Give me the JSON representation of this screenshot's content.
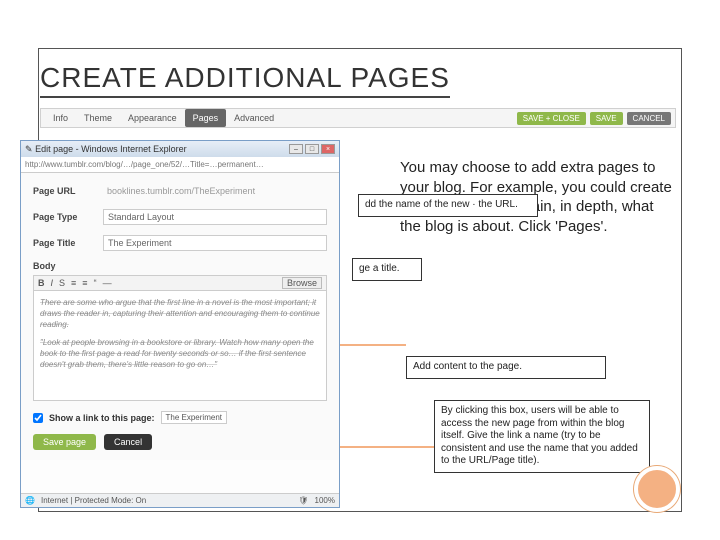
{
  "title": "CREATE ADDITIONAL PAGES",
  "toolbar": {
    "tabs": [
      "Info",
      "Theme",
      "Appearance",
      "Pages",
      "Advanced"
    ],
    "active_index": 3,
    "buttons": {
      "save_close": "SAVE + CLOSE",
      "save": "SAVE",
      "cancel": "CANCEL"
    }
  },
  "browser": {
    "window_title": "Edit page - Windows Internet Explorer",
    "address": "http://www.tumblr.com/blog/…/page_one/52/…Title=…permanent…",
    "page_url_label": "Page URL",
    "page_url_value": "booklines.tumblr.com/TheExperiment",
    "page_type_label": "Page Type",
    "page_type_value": "Standard Layout",
    "page_title_label": "Page Title",
    "page_title_value": "The Experiment",
    "body_label": "Body",
    "editor_toolbar": [
      "B",
      "I",
      "S",
      "≡",
      "≡",
      "“",
      "—",
      "Browse"
    ],
    "body_text_1": "There are some who argue that the first line in a novel is the most important; it draws the reader in, capturing their attention and encouraging them to continue reading.",
    "body_text_2": "\"Look at people browsing in a bookstore or library. Watch how many open the book to the first page a read for twenty seconds or so… if the first sentence doesn't grab them, there's little reason to go on…\"",
    "show_link_label": "Show a link to this page:",
    "show_link_value": "The Experiment",
    "save_page": "Save page",
    "cancel_page": "Cancel",
    "status": "Internet | Protected Mode: On",
    "zoom": "100%"
  },
  "maintext": "You may choose to add extra pages to your blog. For example, you could create a page that will explain, in depth, what the blog is about. Click 'Pages'.",
  "annotations": {
    "a1": "dd the name of the new · the URL.",
    "a2": "ge a title.",
    "a3": "Add content to the page.",
    "a4": "By clicking this box, users will be able to access the new page from within the blog itself. Give the link a name (try to be consistent and use the name that you added to the URL/Page title)."
  }
}
